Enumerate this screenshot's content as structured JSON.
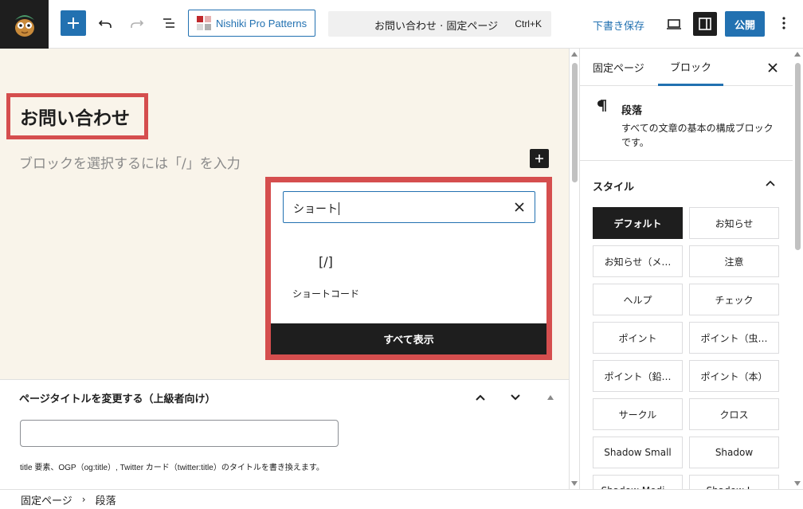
{
  "toolbar": {
    "patterns_label": "Nishiki Pro Patterns",
    "command_title": "お問い合わせ · 固定ページ",
    "command_shortcut": "Ctrl+K",
    "draft_label": "下書き保存",
    "publish_label": "公開"
  },
  "editor": {
    "title": "お問い合わせ",
    "placeholder": "ブロックを選択するには「/」を入力"
  },
  "inserter": {
    "search_value": "ショート",
    "results": [
      {
        "icon_text": "[/]",
        "label": "ショートコード"
      }
    ],
    "show_all_label": "すべて表示"
  },
  "metabox": {
    "title": "ページタイトルを変更する（上級者向け）",
    "input_value": "",
    "description": "title 要素、OGP（og:title）, Twitter カード（twitter:title）のタイトルを書き換えます。"
  },
  "sidebar": {
    "tabs": [
      "固定ページ",
      "ブロック"
    ],
    "block": {
      "name": "段落",
      "description": "すべての文章の基本の構成ブロックです。"
    },
    "styles_heading": "スタイル",
    "styles": [
      "デフォルト",
      "お知らせ",
      "お知らせ（メ…",
      "注意",
      "ヘルプ",
      "チェック",
      "ポイント",
      "ポイント（虫…",
      "ポイント（鉛…",
      "ポイント（本）",
      "サークル",
      "クロス",
      "Shadow Small",
      "Shadow",
      "Shadow Medi…",
      "Shadow L…"
    ]
  },
  "breadcrumb": [
    "固定ページ",
    "段落"
  ],
  "colors": {
    "accent": "#2271b1",
    "highlight_border": "#d54e4e",
    "canvas_bg": "#f9f4ea",
    "dark": "#1e1e1e"
  }
}
